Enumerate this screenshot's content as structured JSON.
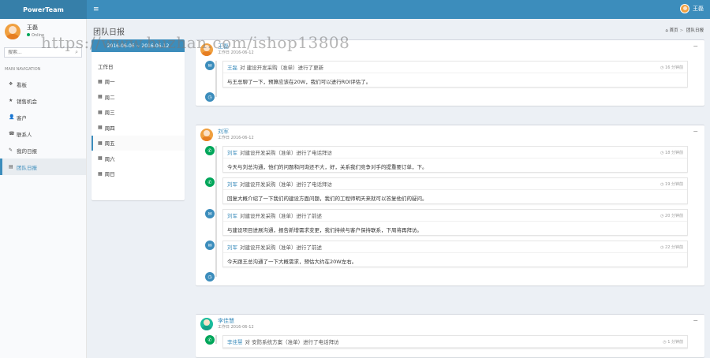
{
  "app": {
    "brand": "PowerTeam",
    "toggle_icon": "≡"
  },
  "topbar": {
    "user_name": "王磊"
  },
  "sidebar": {
    "user_name": "王磊",
    "status": "Online",
    "search_placeholder": "搜索...",
    "nav_header": "MAIN NAVIGATION",
    "items": [
      {
        "label": "看板",
        "icon": "dashboard-icon",
        "glyph": "❖"
      },
      {
        "label": "销售机会",
        "icon": "opportunity-icon",
        "glyph": "★"
      },
      {
        "label": "客户",
        "icon": "customer-icon",
        "glyph": "👤"
      },
      {
        "label": "联系人",
        "icon": "contact-icon",
        "glyph": "☎"
      },
      {
        "label": "我的日报",
        "icon": "my-report-icon",
        "glyph": "✎"
      },
      {
        "label": "团队日报",
        "icon": "team-report-icon",
        "glyph": "▤"
      }
    ]
  },
  "page": {
    "title": "团队日报"
  },
  "breadcrumb": {
    "home": "首页",
    "current": "团队日报",
    "home_icon": "⌂"
  },
  "date_panel": {
    "header": "2016-06-06 ~ 2016-06-12",
    "days": [
      {
        "label": "工作日"
      },
      {
        "label": "周一"
      },
      {
        "label": "周二"
      },
      {
        "label": "周三"
      },
      {
        "label": "周四"
      },
      {
        "label": "周五"
      },
      {
        "label": "周六"
      },
      {
        "label": "周日"
      }
    ]
  },
  "watermark": "https://www.huzhan.com/ishop13808",
  "cards": [
    {
      "name": "王磊",
      "date": "工作日 2016-06-12",
      "entries": [
        {
          "icon": "note-icon",
          "color": "blue",
          "user": "王磊",
          "action": "对 建设开发采购（准单）进行了更新",
          "time": "16 分钟前",
          "body": "与王总聊了一下，预算应该在20W，我们可以进行ROI评估了。"
        }
      ]
    },
    {
      "name": "刘军",
      "date": "工作日 2016-06-12",
      "entries": [
        {
          "icon": "phone-icon",
          "color": "green",
          "user": "刘军",
          "action": "对建设开发采购（准单）进行了电话拜访",
          "time": "18 分钟前",
          "body": "今天与刘总沟通，他们的问题和问询还不大，好，关系我们竞争对手的提重要订单，下。"
        },
        {
          "icon": "phone-icon",
          "color": "green",
          "user": "刘军",
          "action": "对建设开发采购（准单）进行了电话拜访",
          "time": "19 分钟前",
          "body": "回复大概介绍了一下我们的建设方面问题，我们的工程师明天来就可以答复他们的疑问。"
        },
        {
          "icon": "note-icon",
          "color": "blue",
          "user": "刘军",
          "action": "对建设开发采购（准单）进行了前述",
          "time": "20 分钟前",
          "body": "与建设项目进展沟通，报告新增需求变更，我们持续与客户保持联系，下周将再拜访。"
        },
        {
          "icon": "note-icon",
          "color": "blue",
          "user": "刘军",
          "action": "对建设开发采购（准单）进行了前述",
          "time": "22 分钟前",
          "body": "今天跟王总沟通了一下大概需求，预估大约在20W左右。"
        }
      ]
    },
    {
      "name": "李佳慧",
      "date": "工作日 2016-06-12",
      "entries": [
        {
          "icon": "phone-icon",
          "color": "green",
          "user": "李佳慧",
          "action": "对 安防系统方案（准单）进行了电话拜访",
          "time": "1 分钟前",
          "body": ""
        }
      ]
    }
  ]
}
